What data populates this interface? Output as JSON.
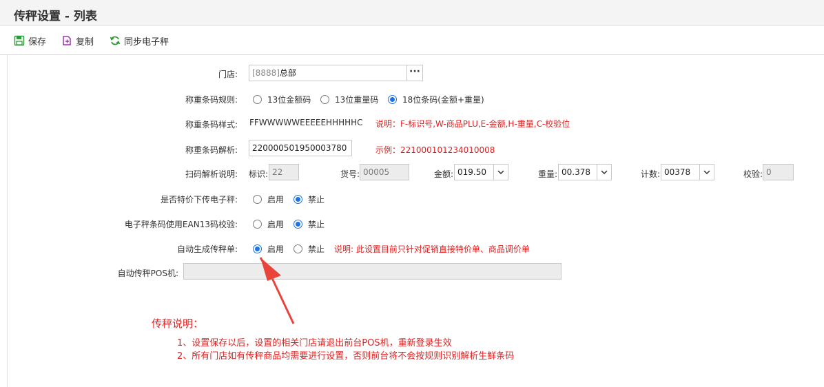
{
  "page": {
    "title": "传秤设置 - 列表"
  },
  "toolbar": {
    "save": "保存",
    "copy": "复制",
    "sync": "同步电子秤"
  },
  "form": {
    "store": {
      "label": "门店:",
      "code": "[8888]",
      "name": "总部",
      "ellipsis": "···"
    },
    "barcode_rule": {
      "label": "称重条码规则:",
      "options": [
        "13位金额码",
        "13位重量码",
        "18位条码(金额+重量)"
      ],
      "selected": "18位条码(金额+重量)"
    },
    "barcode_style": {
      "label": "称重条码样式:",
      "value": "FFWWWWWEEEEEHHHHHC",
      "note": "说明：F-标识号,W-商品PLU,E-金额,H-重量,C-校验位"
    },
    "barcode_parse": {
      "label": "称重条码解析:",
      "value": "220000501950003780",
      "example": "示例：221000101234010008"
    },
    "scan_explain": {
      "label": "扫码解析说明:",
      "flag_label": "标识:",
      "flag_value": "22",
      "goods_label": "货号:",
      "goods_value": "00005",
      "amount_label": "金额:",
      "amount_value": "019.50",
      "weight_label": "重量:",
      "weight_value": "00.378",
      "count_label": "计数:",
      "count_value": "00378",
      "check_label": "校验:",
      "check_value": "0"
    },
    "special_price": {
      "label": "是否特价下传电子秤:",
      "enable": "启用",
      "disable": "禁止",
      "selected": "禁止"
    },
    "ean13": {
      "label": "电子秤条码使用EAN13码校验:",
      "enable": "启用",
      "disable": "禁止",
      "selected": "禁止"
    },
    "auto_generate": {
      "label": "自动生成传秤单:",
      "enable": "启用",
      "disable": "禁止",
      "selected": "启用",
      "note": "说明: 此设置目前只针对促销直接特价单、商品调价单"
    },
    "auto_pos": {
      "label": "自动传秤POS机:",
      "value": ""
    }
  },
  "notes": {
    "title": "传秤说明：",
    "items": [
      "1、设置保存以后，设置的相关门店请退出前台POS机，重新登录生效",
      "2、所有门店如有传秤商品均需要进行设置，否则前台将不会按规则识别解析生鲜条码"
    ]
  },
  "colors": {
    "accent": "#1a73e8",
    "note_red": "#e02020",
    "save_icon": "#2e9a3a",
    "copy_icon": "#a030b0",
    "sync_icon": "#2e9a3a"
  },
  "icons": {
    "save": "save-icon",
    "copy": "copy-icon",
    "sync": "sync-icon",
    "select": "chevron-down-icon"
  }
}
